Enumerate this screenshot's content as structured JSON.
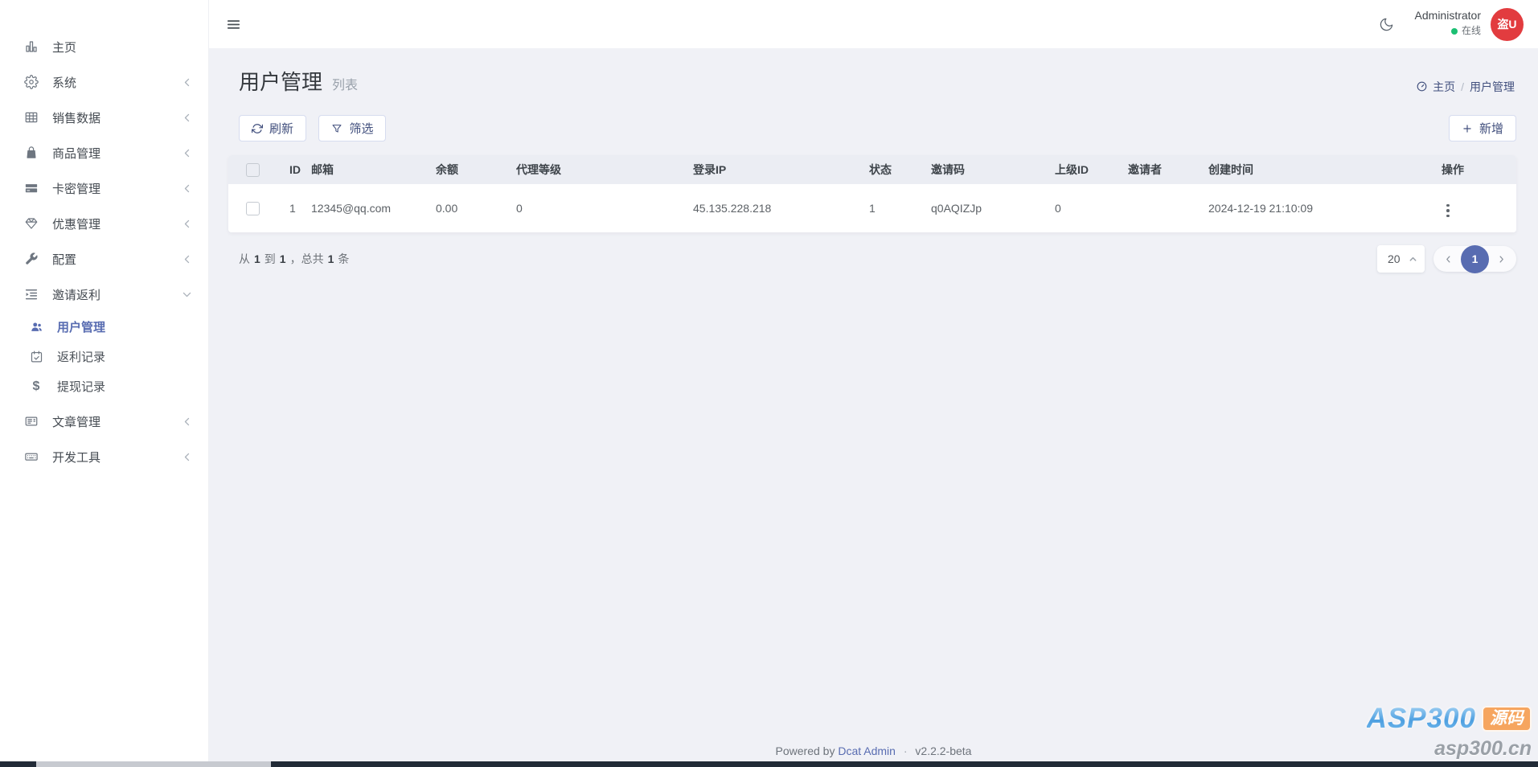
{
  "colors": {
    "primary": "#586cb1",
    "page_bg": "#f0f1f6",
    "avatar_bg": "#e23c3f",
    "online_dot": "#1cbf73",
    "watermark_blue": "#4d9fe0",
    "watermark_orange": "#f6a55f"
  },
  "user": {
    "name": "Administrator",
    "status": "在线",
    "avatar_text": "盗U"
  },
  "sidebar": {
    "items": [
      {
        "label": "主页",
        "icon": "chart-bar-icon"
      },
      {
        "label": "系统",
        "icon": "gear-icon",
        "chevron": "left"
      },
      {
        "label": "销售数据",
        "icon": "table-icon",
        "chevron": "left"
      },
      {
        "label": "商品管理",
        "icon": "shopping-bag-icon",
        "chevron": "left"
      },
      {
        "label": "卡密管理",
        "icon": "credit-card-icon",
        "chevron": "left"
      },
      {
        "label": "优惠管理",
        "icon": "gem-icon",
        "chevron": "left"
      },
      {
        "label": "配置",
        "icon": "wrench-icon",
        "chevron": "left"
      },
      {
        "label": "邀请返利",
        "icon": "indent-list-icon",
        "chevron": "down",
        "expanded": true,
        "children": [
          {
            "label": "用户管理",
            "icon": "users-icon",
            "active": true
          },
          {
            "label": "返利记录",
            "icon": "calendar-check-icon"
          },
          {
            "label": "提现记录",
            "icon": "dollar-icon",
            "icon_glyph": "$"
          }
        ]
      },
      {
        "label": "文章管理",
        "icon": "newspaper-icon",
        "chevron": "left"
      },
      {
        "label": "开发工具",
        "icon": "keyboard-icon",
        "chevron": "left"
      }
    ]
  },
  "page": {
    "title": "用户管理",
    "subtitle": "列表"
  },
  "breadcrumb": {
    "home": "主页",
    "sep": "/",
    "current": "用户管理"
  },
  "toolbar": {
    "refresh_label": "刷新",
    "filter_label": "筛选",
    "create_label": "新增"
  },
  "table": {
    "columns": [
      "ID",
      "邮箱",
      "余额",
      "代理等级",
      "登录IP",
      "状态",
      "邀请码",
      "上级ID",
      "邀请者",
      "创建时间",
      "操作"
    ],
    "rows": [
      {
        "cells": [
          "1",
          "12345@qq.com",
          "0.00",
          "0",
          "45.135.228.218",
          "1",
          "q0AQIZJp",
          "0",
          "",
          "2024-12-19 21:10:09"
        ]
      }
    ]
  },
  "pagination": {
    "summary": {
      "from_label": "从",
      "from": "1",
      "to_label": "到",
      "to": "1",
      "total_label": "，总共",
      "total": "1",
      "unit": "条"
    },
    "per_page": "20",
    "page": "1"
  },
  "footer": {
    "powered": "Powered by",
    "brand": "Dcat Admin",
    "sep": "·",
    "version": "v2.2.2-beta"
  },
  "watermark": {
    "brand": "ASP300",
    "badge": "源码",
    "domain": "asp300.cn"
  }
}
